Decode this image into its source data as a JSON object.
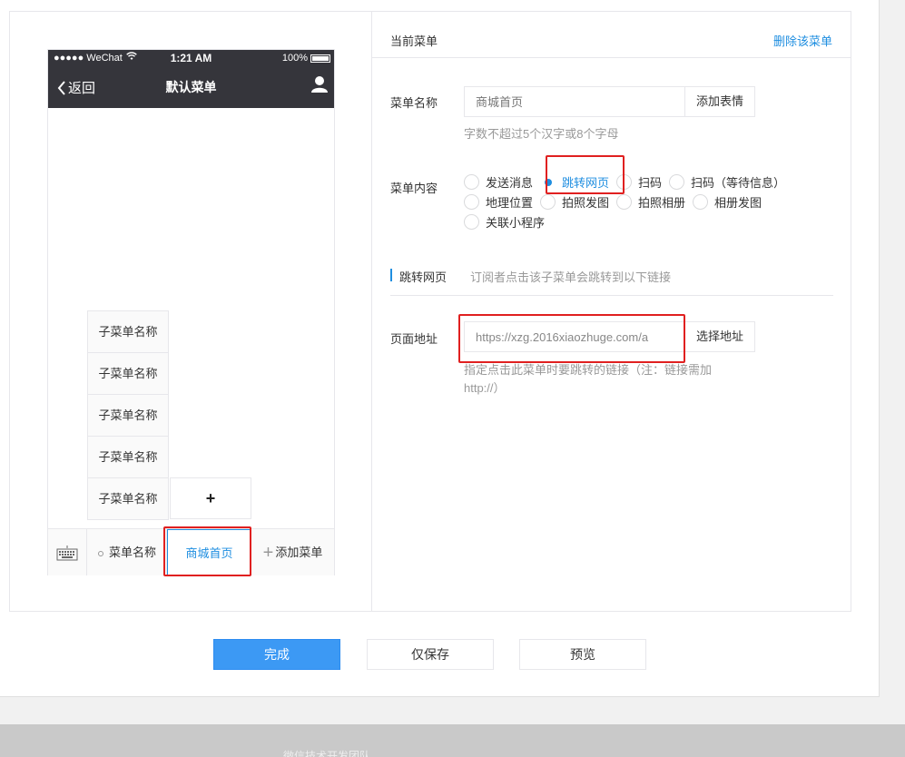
{
  "phone": {
    "carrier": "●●●●● WeChat",
    "time": "1:21 AM",
    "battery": "100%",
    "back_label": "返回",
    "title": "默认菜单"
  },
  "sub_menu": {
    "items": [
      "子菜单名称",
      "子菜单名称",
      "子菜单名称",
      "子菜单名称",
      "子菜单名称"
    ],
    "add_symbol": "+"
  },
  "menu_bar": {
    "items": [
      "菜单名称",
      "商城首页",
      "添加菜单"
    ],
    "add_symbol": "+"
  },
  "panel": {
    "title": "当前菜单",
    "delete_label": "删除该菜单",
    "name_label": "菜单名称",
    "name_placeholder": "商城首页",
    "emoji_button": "添加表情",
    "name_hint": "字数不超过5个汉字或8个字母",
    "content_label": "菜单内容",
    "options_row1": [
      "发送消息",
      "跳转网页",
      "扫码",
      "扫码（等待信息）"
    ],
    "options_row2": [
      "地理位置",
      "拍照发图",
      "拍照相册",
      "相册发图"
    ],
    "options_row3": [
      "关联小程序"
    ],
    "section_name": "跳转网页",
    "section_desc": "订阅者点击该子菜单会跳转到以下链接",
    "url_label": "页面地址",
    "url_value": "https://xzg.2016xiaozhuge.com/a",
    "select_button": "选择地址",
    "url_hint_line1": "指定点击此菜单时要跳转的链接（注：链接需加",
    "url_hint_line2": "http://）"
  },
  "actions": {
    "done": "完成",
    "save_only": "仅保存",
    "preview": "预览"
  },
  "footer": {
    "text": "微信技术开发团队"
  },
  "colors": {
    "accent": "#1f8ee0",
    "primary_button": "#3c99f4",
    "highlight": "#e02020",
    "phone_header": "#35353b"
  }
}
